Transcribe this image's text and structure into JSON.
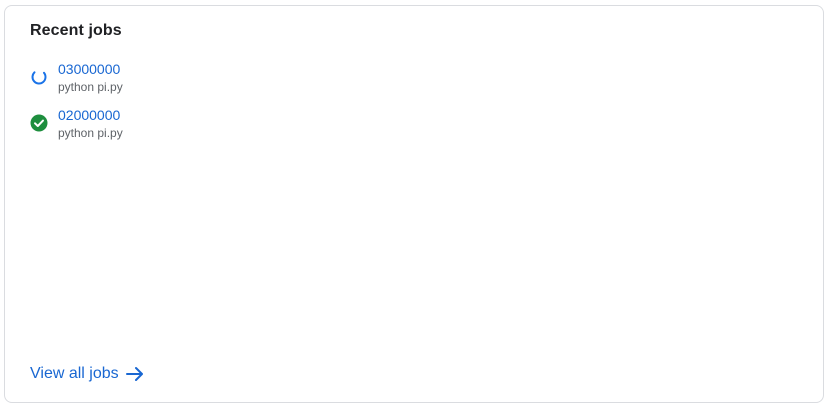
{
  "card": {
    "title": "Recent jobs",
    "view_all_label": "View all jobs"
  },
  "jobs": [
    {
      "id": "03000000",
      "command": "python pi.py",
      "status": "running",
      "status_icon": "spinner-icon"
    },
    {
      "id": "02000000",
      "command": "python pi.py",
      "status": "succeeded",
      "status_icon": "check-circle-icon"
    }
  ],
  "colors": {
    "link": "#1967d2",
    "running": "#1a73e8",
    "success": "#1e8e3e",
    "border": "#dadce0"
  }
}
